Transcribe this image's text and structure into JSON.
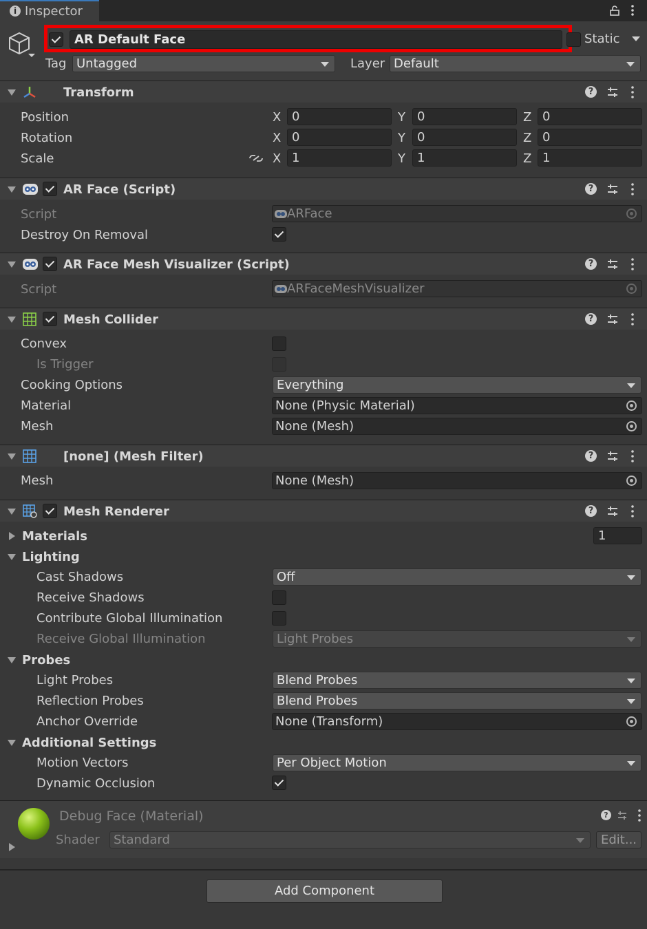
{
  "window": {
    "tab_title": "Inspector"
  },
  "object": {
    "name": "AR Default Face",
    "active": true,
    "static_label": "Static",
    "tag_label": "Tag",
    "tag_value": "Untagged",
    "layer_label": "Layer",
    "layer_value": "Default"
  },
  "transform": {
    "title": "Transform",
    "position_label": "Position",
    "rotation_label": "Rotation",
    "scale_label": "Scale",
    "axis_x": "X",
    "axis_y": "Y",
    "axis_z": "Z",
    "position": {
      "x": "0",
      "y": "0",
      "z": "0"
    },
    "rotation": {
      "x": "0",
      "y": "0",
      "z": "0"
    },
    "scale": {
      "x": "1",
      "y": "1",
      "z": "1"
    }
  },
  "ar_face": {
    "title": "AR Face (Script)",
    "script_label": "Script",
    "script_value": "ARFace",
    "destroy_label": "Destroy On Removal",
    "destroy_checked": true
  },
  "ar_face_mesh_vis": {
    "title": "AR Face Mesh Visualizer (Script)",
    "script_label": "Script",
    "script_value": "ARFaceMeshVisualizer"
  },
  "mesh_collider": {
    "title": "Mesh Collider",
    "convex_label": "Convex",
    "is_trigger_label": "Is Trigger",
    "cooking_label": "Cooking Options",
    "cooking_value": "Everything",
    "material_label": "Material",
    "material_value": "None (Physic Material)",
    "mesh_label": "Mesh",
    "mesh_value": "None (Mesh)"
  },
  "mesh_filter": {
    "title": "[none] (Mesh Filter)",
    "mesh_label": "Mesh",
    "mesh_value": "None (Mesh)"
  },
  "mesh_renderer": {
    "title": "Mesh Renderer",
    "materials_label": "Materials",
    "materials_count": "1",
    "lighting_label": "Lighting",
    "cast_shadows_label": "Cast Shadows",
    "cast_shadows_value": "Off",
    "receive_shadows_label": "Receive Shadows",
    "contribute_gi_label": "Contribute Global Illumination",
    "receive_gi_label": "Receive Global Illumination",
    "receive_gi_value": "Light Probes",
    "probes_label": "Probes",
    "light_probes_label": "Light Probes",
    "light_probes_value": "Blend Probes",
    "reflection_probes_label": "Reflection Probes",
    "reflection_probes_value": "Blend Probes",
    "anchor_override_label": "Anchor Override",
    "anchor_override_value": "None (Transform)",
    "additional_label": "Additional Settings",
    "motion_vectors_label": "Motion Vectors",
    "motion_vectors_value": "Per Object Motion",
    "dynamic_occlusion_label": "Dynamic Occlusion",
    "dynamic_occlusion_checked": true
  },
  "material": {
    "title": "Debug Face (Material)",
    "shader_label": "Shader",
    "shader_value": "Standard",
    "edit_label": "Edit..."
  },
  "footer": {
    "add_component_label": "Add Component"
  },
  "colors": {
    "highlight_box": "#ee0000",
    "material_preview": "#8bc11a"
  }
}
